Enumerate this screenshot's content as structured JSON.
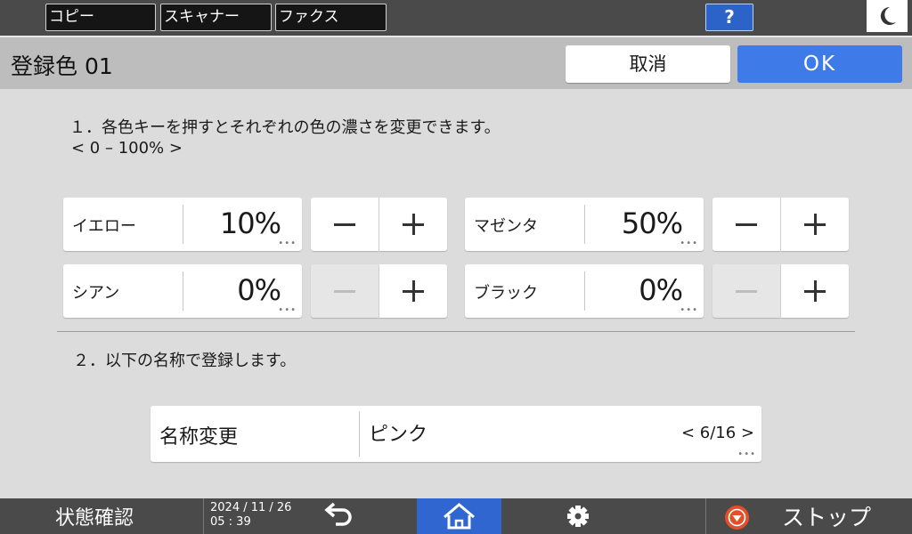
{
  "top_tabs": [
    "コピー",
    "スキャナー",
    "ファクス"
  ],
  "help_label": "?",
  "header": {
    "title": "登録色 01",
    "cancel_label": "取消",
    "ok_label": "OK"
  },
  "instructions": {
    "line1": "１．各色キーを押すとそれぞれの色の濃さを変更できます。",
    "range": "< 0 – 100% >",
    "line2": "２．以下の名称で登録します。"
  },
  "colors": [
    {
      "name": "イエロー",
      "value": "10%"
    },
    {
      "name": "マゼンタ",
      "value": "50%"
    },
    {
      "name": "シアン",
      "value": "0%"
    },
    {
      "name": "ブラック",
      "value": "0%"
    }
  ],
  "name_field": {
    "label": "名称変更",
    "value": "ピンク",
    "count": "< 6/16 >"
  },
  "bottom": {
    "status_label": "状態確認",
    "date": "2024 / 11 / 26",
    "time": "05 : 39",
    "stop_label": "ストップ"
  },
  "accent_colors": {
    "ok": "#3f7be8",
    "home": "#2f66cf",
    "stop": "#e1502a"
  },
  "icons": [
    "moon-icon",
    "back-arrow-icon",
    "home-icon",
    "gear-icon",
    "stop-icon"
  ]
}
